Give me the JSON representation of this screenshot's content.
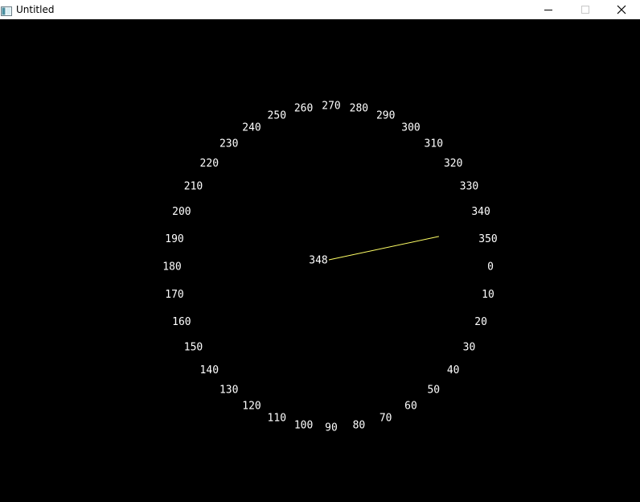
{
  "window": {
    "title": "Untitled"
  },
  "dial": {
    "labels": [
      "0",
      "10",
      "20",
      "30",
      "40",
      "50",
      "60",
      "70",
      "80",
      "90",
      "100",
      "110",
      "120",
      "130",
      "140",
      "150",
      "160",
      "170",
      "180",
      "190",
      "200",
      "210",
      "220",
      "230",
      "240",
      "250",
      "260",
      "270",
      "280",
      "290",
      "300",
      "310",
      "320",
      "330",
      "340",
      "350"
    ],
    "current_reading": "348",
    "needle_angle_deg": 348,
    "colors": {
      "background": "#000000",
      "labels": "#ffffff",
      "needle": "#ffff66"
    }
  }
}
